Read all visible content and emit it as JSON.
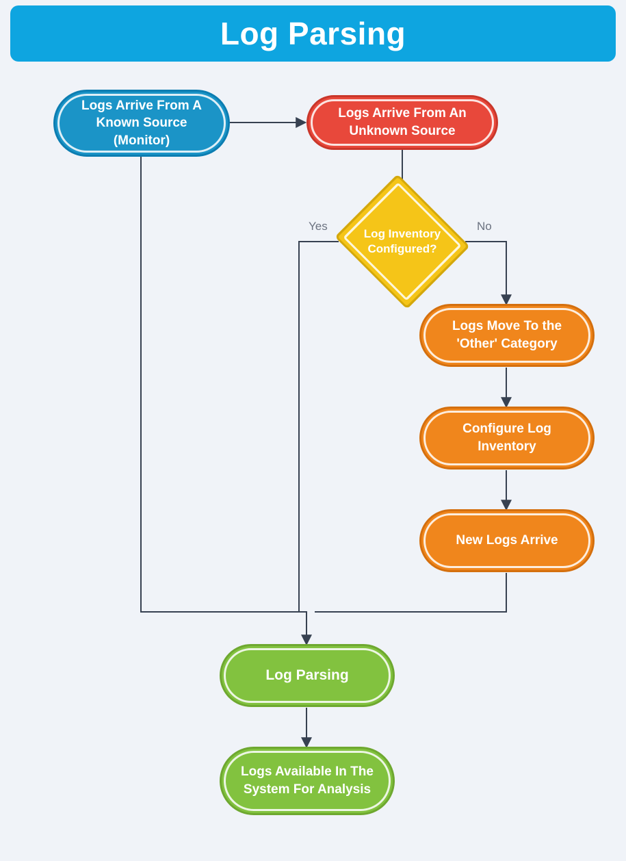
{
  "title": "Log Parsing",
  "nodes": {
    "known_source": "Logs Arrive From A Known Source (Monitor)",
    "unknown_source": "Logs Arrive From An Unknown Source",
    "decision": "Log Inventory Configured?",
    "yes_label": "Yes",
    "no_label": "No",
    "other_category": "Logs Move To the 'Other' Category",
    "configure_inventory": "Configure Log Inventory",
    "new_logs": "New Logs Arrive",
    "log_parsing": "Log Parsing",
    "logs_available": "Logs Available In The System For Analysis"
  },
  "chart_data": {
    "type": "flowchart",
    "title": "Log Parsing",
    "nodes": [
      {
        "id": "A",
        "label": "Logs Arrive From A Known Source (Monitor)",
        "shape": "terminator",
        "color": "blue"
      },
      {
        "id": "B",
        "label": "Logs Arrive From An Unknown Source",
        "shape": "terminator",
        "color": "red"
      },
      {
        "id": "C",
        "label": "Log Inventory Configured?",
        "shape": "decision",
        "color": "yellow"
      },
      {
        "id": "D",
        "label": "Logs Move To the 'Other' Category",
        "shape": "terminator",
        "color": "orange"
      },
      {
        "id": "E",
        "label": "Configure Log Inventory",
        "shape": "terminator",
        "color": "orange"
      },
      {
        "id": "F",
        "label": "New Logs Arrive",
        "shape": "terminator",
        "color": "orange"
      },
      {
        "id": "G",
        "label": "Log Parsing",
        "shape": "terminator",
        "color": "green"
      },
      {
        "id": "H",
        "label": "Logs Available In The System For Analysis",
        "shape": "terminator",
        "color": "green"
      }
    ],
    "edges": [
      {
        "from": "A",
        "to": "B"
      },
      {
        "from": "A",
        "to": "G"
      },
      {
        "from": "B",
        "to": "C"
      },
      {
        "from": "C",
        "to": "G",
        "label": "Yes"
      },
      {
        "from": "C",
        "to": "D",
        "label": "No"
      },
      {
        "from": "D",
        "to": "E"
      },
      {
        "from": "E",
        "to": "F"
      },
      {
        "from": "F",
        "to": "G"
      },
      {
        "from": "G",
        "to": "H"
      }
    ]
  }
}
